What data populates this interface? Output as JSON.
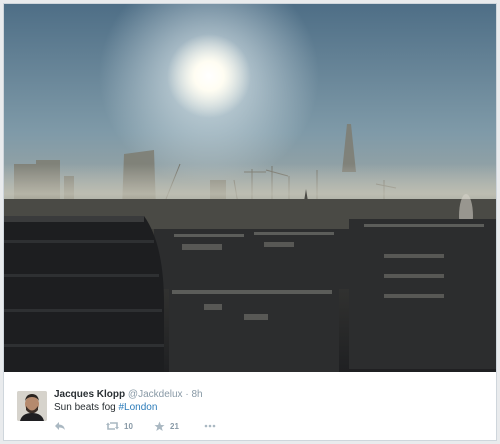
{
  "tweet": {
    "author_name": "Jacques Klopp",
    "author_handle": "@Jackdelux",
    "separator": "·",
    "timestamp": "8h",
    "text_prefix": "Sun beats fog",
    "hashtag": "#London",
    "retweet_count": "10",
    "favorite_count": "21"
  },
  "icons": {
    "reply": "reply-icon",
    "retweet": "retweet-icon",
    "favorite": "star-icon",
    "more": "more-icon"
  },
  "colors": {
    "name": "#292f33",
    "meta": "#8899a6",
    "hashtag": "#2b7bb9",
    "action_icon": "#aab8c2"
  }
}
